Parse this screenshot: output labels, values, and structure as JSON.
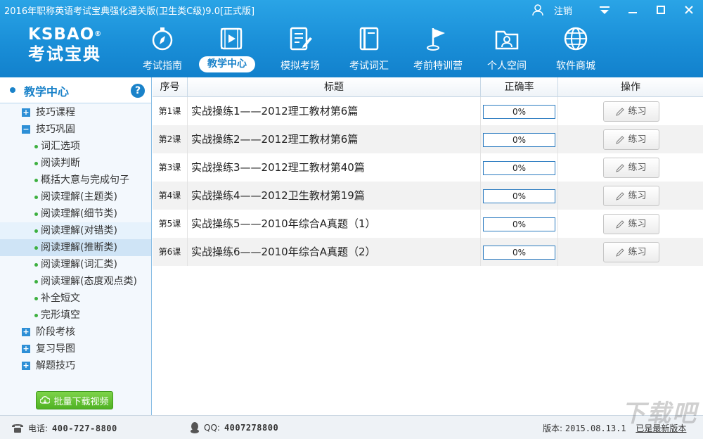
{
  "window": {
    "title": "2016年职称英语考试宝典强化通关版(卫生类C级)9.0[正式版]",
    "logout_label": "注销"
  },
  "logo": {
    "top": "KSBAO",
    "reg": "®",
    "bottom": "考试宝典"
  },
  "nav": {
    "items": [
      {
        "label": "考试指南",
        "icon": "compass-icon"
      },
      {
        "label": "教学中心",
        "icon": "video-icon",
        "active": true
      },
      {
        "label": "模拟考场",
        "icon": "edit-document-icon"
      },
      {
        "label": "考试词汇",
        "icon": "book-icon"
      },
      {
        "label": "考前特训营",
        "icon": "flag-icon"
      },
      {
        "label": "个人空间",
        "icon": "person-folder-icon"
      },
      {
        "label": "软件商城",
        "icon": "globe-icon"
      }
    ]
  },
  "sidebar": {
    "title": "教学中心",
    "help": "?",
    "download_label": "批量下载视频",
    "tree": [
      {
        "label": "技巧课程",
        "level": 0,
        "toggle": "+"
      },
      {
        "label": "技巧巩固",
        "level": 0,
        "toggle": "−"
      },
      {
        "label": "词汇选项",
        "level": 1
      },
      {
        "label": "阅读判断",
        "level": 1
      },
      {
        "label": "概括大意与完成句子",
        "level": 1
      },
      {
        "label": "阅读理解(主题类)",
        "level": 1
      },
      {
        "label": "阅读理解(细节类)",
        "level": 1
      },
      {
        "label": "阅读理解(对错类)",
        "level": 1,
        "state": "hover"
      },
      {
        "label": "阅读理解(推断类)",
        "level": 1,
        "state": "selected"
      },
      {
        "label": "阅读理解(词汇类)",
        "level": 1
      },
      {
        "label": "阅读理解(态度观点类)",
        "level": 1
      },
      {
        "label": "补全短文",
        "level": 1
      },
      {
        "label": "完形填空",
        "level": 1
      },
      {
        "label": "阶段考核",
        "level": 0,
        "toggle": "+"
      },
      {
        "label": "复习导图",
        "level": 0,
        "toggle": "+"
      },
      {
        "label": "解题技巧",
        "level": 0,
        "toggle": "+"
      }
    ]
  },
  "table": {
    "headers": {
      "num": "序号",
      "title": "标题",
      "rate": "正确率",
      "op": "操作"
    },
    "action_label": "练习",
    "rows": [
      {
        "num": "第1课",
        "title": "实战操练1——2012理工教材第6篇",
        "rate": "0%"
      },
      {
        "num": "第2课",
        "title": "实战操练2——2012理工教材第6篇",
        "rate": "0%"
      },
      {
        "num": "第3课",
        "title": "实战操练3——2012理工教材第40篇",
        "rate": "0%"
      },
      {
        "num": "第4课",
        "title": "实战操练4——2012卫生教材第19篇",
        "rate": "0%"
      },
      {
        "num": "第5课",
        "title": "实战操练5——2010年综合A真题（1）",
        "rate": "0%"
      },
      {
        "num": "第6课",
        "title": "实战操练6——2010年综合A真题（2）",
        "rate": "0%"
      }
    ]
  },
  "status": {
    "phone_label": "电话:",
    "phone": "400-727-8800",
    "qq_label": "QQ:",
    "qq": "4007278800",
    "version_label": "版本:",
    "version": "2015.08.13.1",
    "latest": "已是最新版本",
    "watermark": "下载吧"
  },
  "colors": {
    "header": "#1a8fd8",
    "accent": "#1a82c9",
    "download": "#4fb223"
  }
}
